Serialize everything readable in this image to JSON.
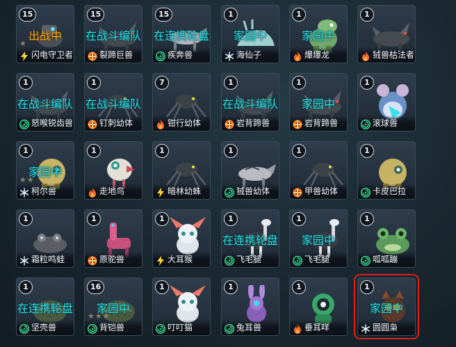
{
  "colors": {
    "status_cyan": "#2ee0e6",
    "status_orange": "#ffae1a",
    "selection_outline": "#e01e1e"
  },
  "cards": [
    {
      "count": "15",
      "status": "出战中",
      "status_color": "orange",
      "element": "lightning",
      "name": "闪电守卫者",
      "stars": 1,
      "creature": "bot"
    },
    {
      "count": "15",
      "status": "在战斗编队",
      "element": "fire-fist",
      "name": "裂蹄巨兽",
      "creature": "beast"
    },
    {
      "count": "15",
      "status": "在连携轮盘",
      "element": "wind",
      "name": "疾奔兽",
      "creature": "wolf"
    },
    {
      "count": "1",
      "status": "家园中",
      "element": "ice",
      "name": "海仙子",
      "creature": "slug"
    },
    {
      "count": "1",
      "status": "家园中",
      "element": "fire",
      "name": "爆爆龙",
      "creature": "dino"
    },
    {
      "count": "1",
      "status": "",
      "element": "fire",
      "name": "狨兽枯法者",
      "creature": "beast"
    },
    {
      "count": "1",
      "status": "在战斗编队",
      "element": "wind",
      "name": "怒喉锐齿兽",
      "creature": "beast"
    },
    {
      "count": "1",
      "status": "在战斗编队",
      "element": "fire-fist",
      "name": "钉刺幼体",
      "creature": "spider"
    },
    {
      "count": "7",
      "status": "",
      "element": "fire",
      "name": "钳行幼体",
      "creature": "spider"
    },
    {
      "count": "1",
      "status": "在战斗编队",
      "element": "fire-fist",
      "name": "岩背蹄兽",
      "creature": "beast"
    },
    {
      "count": "1",
      "status": "家园中",
      "element": "fire-fist",
      "name": "岩背蹄兽",
      "creature": "beast"
    },
    {
      "count": "1",
      "status": "",
      "element": "wind",
      "name": "滚球兽",
      "creature": "mouse"
    },
    {
      "count": "1",
      "status": "家园中",
      "element": "ice",
      "name": "柯尔兽",
      "stars": 2,
      "creature": "round"
    },
    {
      "count": "1",
      "status": "",
      "element": "fire",
      "name": "走地鸟",
      "creature": "bird"
    },
    {
      "count": "1",
      "status": "",
      "element": "lightning",
      "name": "暗林幼蛛",
      "creature": "spider"
    },
    {
      "count": "1",
      "status": "",
      "element": "wind",
      "name": "狨兽幼体",
      "creature": "wolf"
    },
    {
      "count": "1",
      "status": "",
      "element": "fire-fist",
      "name": "甲兽幼体",
      "creature": "spider"
    },
    {
      "count": "1",
      "status": "",
      "element": "wind",
      "name": "卡皮巴拉",
      "creature": "round"
    },
    {
      "count": "1",
      "status": "",
      "element": "ice",
      "name": "霜粒鸣蛙",
      "creature": "frog-dark"
    },
    {
      "count": "1",
      "status": "",
      "element": "fire-fist",
      "name": "原驼兽",
      "creature": "llama"
    },
    {
      "count": "1",
      "status": "",
      "element": "lightning",
      "name": "大耳猴",
      "creature": "cat"
    },
    {
      "count": "1",
      "status": "在连携轮盘",
      "element": "wind",
      "name": "飞毛腿",
      "creature": "ostrich"
    },
    {
      "count": "1",
      "status": "家园中",
      "element": "wind",
      "name": "飞毛腿",
      "creature": "ostrich"
    },
    {
      "count": "1",
      "status": "",
      "element": "wind",
      "name": "呱呱蹦",
      "creature": "frog"
    },
    {
      "count": "1",
      "status": "在连携轮盘",
      "element": "wind",
      "name": "坚壳兽",
      "creature": "shell"
    },
    {
      "count": "16",
      "status": "家园中",
      "element": "wind",
      "name": "背铠兽",
      "stars": 3,
      "creature": "shell"
    },
    {
      "count": "1",
      "status": "",
      "element": "wind",
      "name": "叮叮猫",
      "creature": "cat"
    },
    {
      "count": "1",
      "status": "",
      "element": "wind",
      "name": "兔耳兽",
      "creature": "bunny"
    },
    {
      "count": "1",
      "status": "",
      "element": "fire",
      "name": "垂耳咩",
      "creature": "robot-head"
    },
    {
      "count": "1",
      "status": "家园中",
      "element": "ice",
      "name": "圆圆枭",
      "creature": "owl",
      "selected": true
    }
  ]
}
